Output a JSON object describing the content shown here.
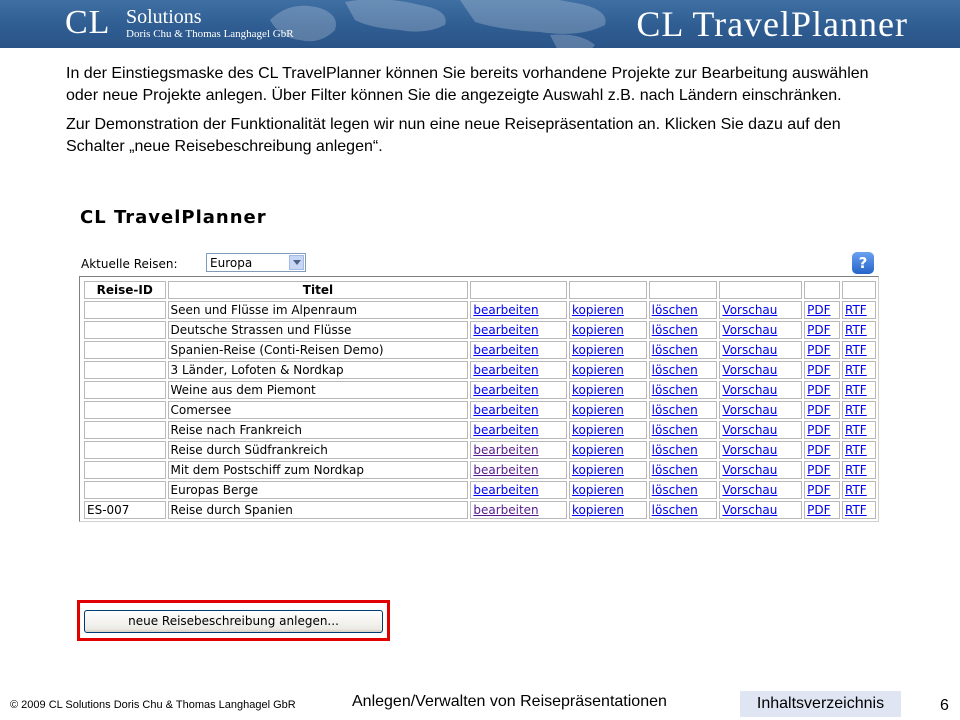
{
  "header": {
    "logo_mark": "CL",
    "logo_name": "Solutions",
    "logo_company": "Doris Chu & Thomas Langhagel GbR",
    "product_title": "CL TravelPlanner"
  },
  "intro": {
    "paragraph1": "In der Einstiegsmaske des CL TravelPlanner können Sie bereits vorhandene Projekte zur Bearbeitung auswählen oder neue Projekte anlegen. Über Filter können Sie die angezeigte Auswahl z.B. nach Ländern einschränken.",
    "paragraph2": "Zur Demonstration der Funktionalität legen wir nun eine neue Reisepräsentation an. Klicken Sie dazu auf den Schalter „neue Reisebeschreibung anlegen“."
  },
  "app": {
    "title": "CL TravelPlanner",
    "filter_label": "Aktuelle Reisen:",
    "filter_value": "Europa",
    "help_label": "?",
    "columns": {
      "id": "Reise-ID",
      "title": "Titel"
    },
    "rows": [
      {
        "id": "",
        "title": "Seen und Flüsse im Alpenraum",
        "edit": "bearbeiten",
        "copy": "kopieren",
        "delete": "löschen",
        "preview": "Vorschau",
        "pdf": "PDF",
        "rtf": "RTF",
        "edit_visited": false
      },
      {
        "id": "",
        "title": "Deutsche Strassen und Flüsse",
        "edit": "bearbeiten",
        "copy": "kopieren",
        "delete": "löschen",
        "preview": "Vorschau",
        "pdf": "PDF",
        "rtf": "RTF",
        "edit_visited": false
      },
      {
        "id": "",
        "title": "Spanien-Reise (Conti-Reisen Demo)",
        "edit": "bearbeiten",
        "copy": "kopieren",
        "delete": "löschen",
        "preview": "Vorschau",
        "pdf": "PDF",
        "rtf": "RTF",
        "edit_visited": false
      },
      {
        "id": "",
        "title": "3 Länder, Lofoten & Nordkap",
        "edit": "bearbeiten",
        "copy": "kopieren",
        "delete": "löschen",
        "preview": "Vorschau",
        "pdf": "PDF",
        "rtf": "RTF",
        "edit_visited": false
      },
      {
        "id": "",
        "title": "Weine aus dem Piemont",
        "edit": "bearbeiten",
        "copy": "kopieren",
        "delete": "löschen",
        "preview": "Vorschau",
        "pdf": "PDF",
        "rtf": "RTF",
        "edit_visited": false
      },
      {
        "id": "",
        "title": "Comersee",
        "edit": "bearbeiten",
        "copy": "kopieren",
        "delete": "löschen",
        "preview": "Vorschau",
        "pdf": "PDF",
        "rtf": "RTF",
        "edit_visited": false
      },
      {
        "id": "",
        "title": "Reise nach Frankreich",
        "edit": "bearbeiten",
        "copy": "kopieren",
        "delete": "löschen",
        "preview": "Vorschau",
        "pdf": "PDF",
        "rtf": "RTF",
        "edit_visited": false
      },
      {
        "id": "",
        "title": "Reise durch Südfrankreich",
        "edit": "bearbeiten",
        "copy": "kopieren",
        "delete": "löschen",
        "preview": "Vorschau",
        "pdf": "PDF",
        "rtf": "RTF",
        "edit_visited": true
      },
      {
        "id": "",
        "title": "Mit dem Postschiff zum Nordkap",
        "edit": "bearbeiten",
        "copy": "kopieren",
        "delete": "löschen",
        "preview": "Vorschau",
        "pdf": "PDF",
        "rtf": "RTF",
        "edit_visited": true
      },
      {
        "id": "",
        "title": "Europas Berge",
        "edit": "bearbeiten",
        "copy": "kopieren",
        "delete": "löschen",
        "preview": "Vorschau",
        "pdf": "PDF",
        "rtf": "RTF",
        "edit_visited": false
      },
      {
        "id": "ES-007",
        "title": "Reise durch Spanien",
        "edit": "bearbeiten",
        "copy": "kopieren",
        "delete": "löschen",
        "preview": "Vorschau",
        "pdf": "PDF",
        "rtf": "RTF",
        "edit_visited": true
      }
    ],
    "new_button_label": "neue Reisebeschreibung anlegen..."
  },
  "colors": {
    "highlight": "#e00000",
    "link": "#0000ee",
    "link_visited": "#551a8b",
    "banner": "#2f5d92"
  },
  "footer": {
    "copyright": "© 2009 CL Solutions Doris Chu & Thomas Langhagel GbR",
    "topic": "Anlegen/Verwalten von Reisepräsentationen",
    "toc_label": "Inhaltsverzeichnis",
    "page_number": "6"
  }
}
